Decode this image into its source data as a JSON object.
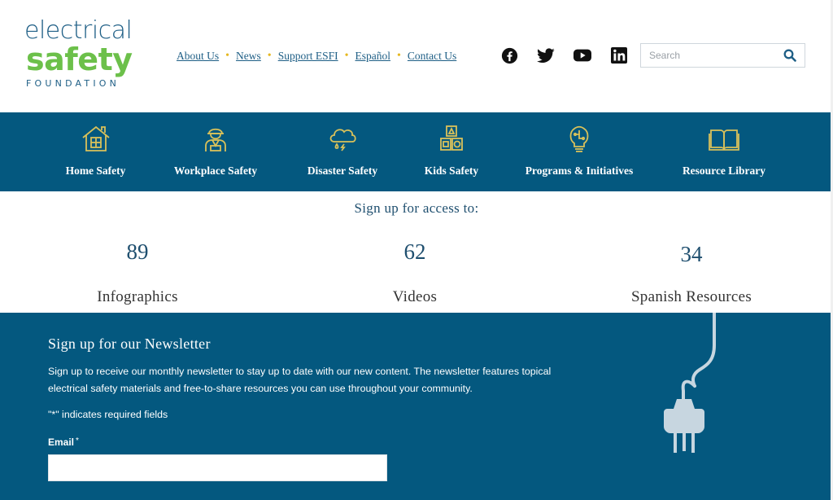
{
  "logo": {
    "line1": "electrical",
    "line2": "safety",
    "line3": "FOUNDATION"
  },
  "top_nav": {
    "links": [
      "About Us",
      "News",
      "Support ESFI",
      "Español",
      "Contact Us"
    ],
    "separator": "•"
  },
  "social": [
    "facebook-icon",
    "twitter-icon",
    "youtube-icon",
    "linkedin-icon"
  ],
  "search": {
    "placeholder": "Search",
    "value": ""
  },
  "main_nav": {
    "items": [
      {
        "label": "Home Safety",
        "icon": "house-icon"
      },
      {
        "label": "Workplace Safety",
        "icon": "worker-icon"
      },
      {
        "label": "Disaster Safety",
        "icon": "storm-cloud-icon"
      },
      {
        "label": "Kids Safety",
        "icon": "blocks-icon"
      },
      {
        "label": "Programs & Initiatives",
        "icon": "lightbulb-icon"
      },
      {
        "label": "Resource Library",
        "icon": "book-icon"
      }
    ]
  },
  "stats": {
    "heading": "Sign up for access to:",
    "items": [
      {
        "number": "89",
        "label": "Infographics"
      },
      {
        "number": "62",
        "label": "Videos"
      },
      {
        "number": "34",
        "label": "Spanish Resources"
      }
    ]
  },
  "newsletter": {
    "title": "Sign up for our Newsletter",
    "description": "Sign up to receive our monthly newsletter to stay up to date with our new content. The newsletter features topical electrical safety materials and free-to-share resources you can use throughout your community.",
    "required_note": "\"*\" indicates required fields",
    "email_label": "Email",
    "required_star": "*",
    "email_value": ""
  },
  "colors": {
    "brand_blue": "#04587f",
    "brand_green": "#6cc04a",
    "icon_gold": "#d9c15a",
    "link_dot": "#e6b820"
  }
}
